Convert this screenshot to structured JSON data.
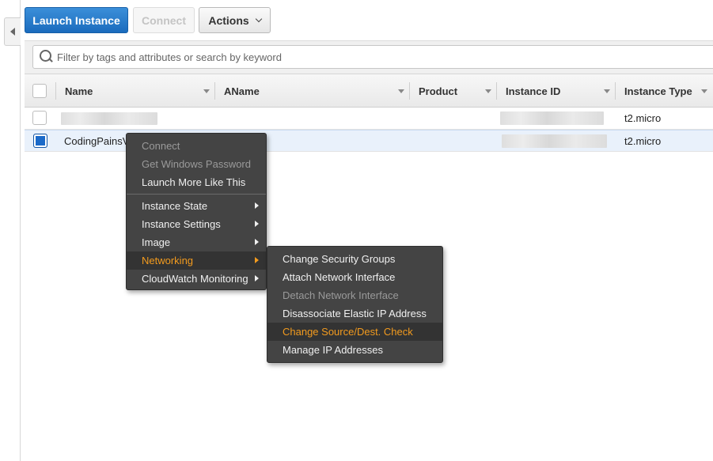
{
  "toolbar": {
    "launch_label": "Launch Instance",
    "connect_label": "Connect",
    "actions_label": "Actions"
  },
  "filter": {
    "placeholder": "Filter by tags and attributes or search by keyword",
    "value": ""
  },
  "table": {
    "columns": [
      "Name",
      "AName",
      "Product",
      "Instance ID",
      "Instance Type"
    ],
    "rows": [
      {
        "name": "",
        "instance_type": "t2.micro",
        "selected": false
      },
      {
        "name": "CodingPainsV",
        "instance_type": "t2.micro",
        "selected": true
      }
    ]
  },
  "context_menu": {
    "items": [
      {
        "label": "Connect",
        "disabled": true
      },
      {
        "label": "Get Windows Password",
        "disabled": true
      },
      {
        "label": "Launch More Like This",
        "disabled": false
      },
      {
        "label": "Instance State",
        "submenu": true
      },
      {
        "label": "Instance Settings",
        "submenu": true
      },
      {
        "label": "Image",
        "submenu": true
      },
      {
        "label": "Networking",
        "submenu": true,
        "active": true
      },
      {
        "label": "CloudWatch Monitoring",
        "submenu": true
      }
    ]
  },
  "networking_submenu": {
    "items": [
      {
        "label": "Change Security Groups",
        "disabled": false
      },
      {
        "label": "Attach Network Interface",
        "disabled": false
      },
      {
        "label": "Detach Network Interface",
        "disabled": true
      },
      {
        "label": "Disassociate Elastic IP Address",
        "disabled": false
      },
      {
        "label": "Change Source/Dest. Check",
        "active": true
      },
      {
        "label": "Manage IP Addresses",
        "disabled": false
      }
    ]
  },
  "colors": {
    "primary_button": "#1a6bbd",
    "menu_bg": "#444444",
    "menu_highlight_text": "#f39b1e",
    "selected_row": "#e9f1fb"
  }
}
